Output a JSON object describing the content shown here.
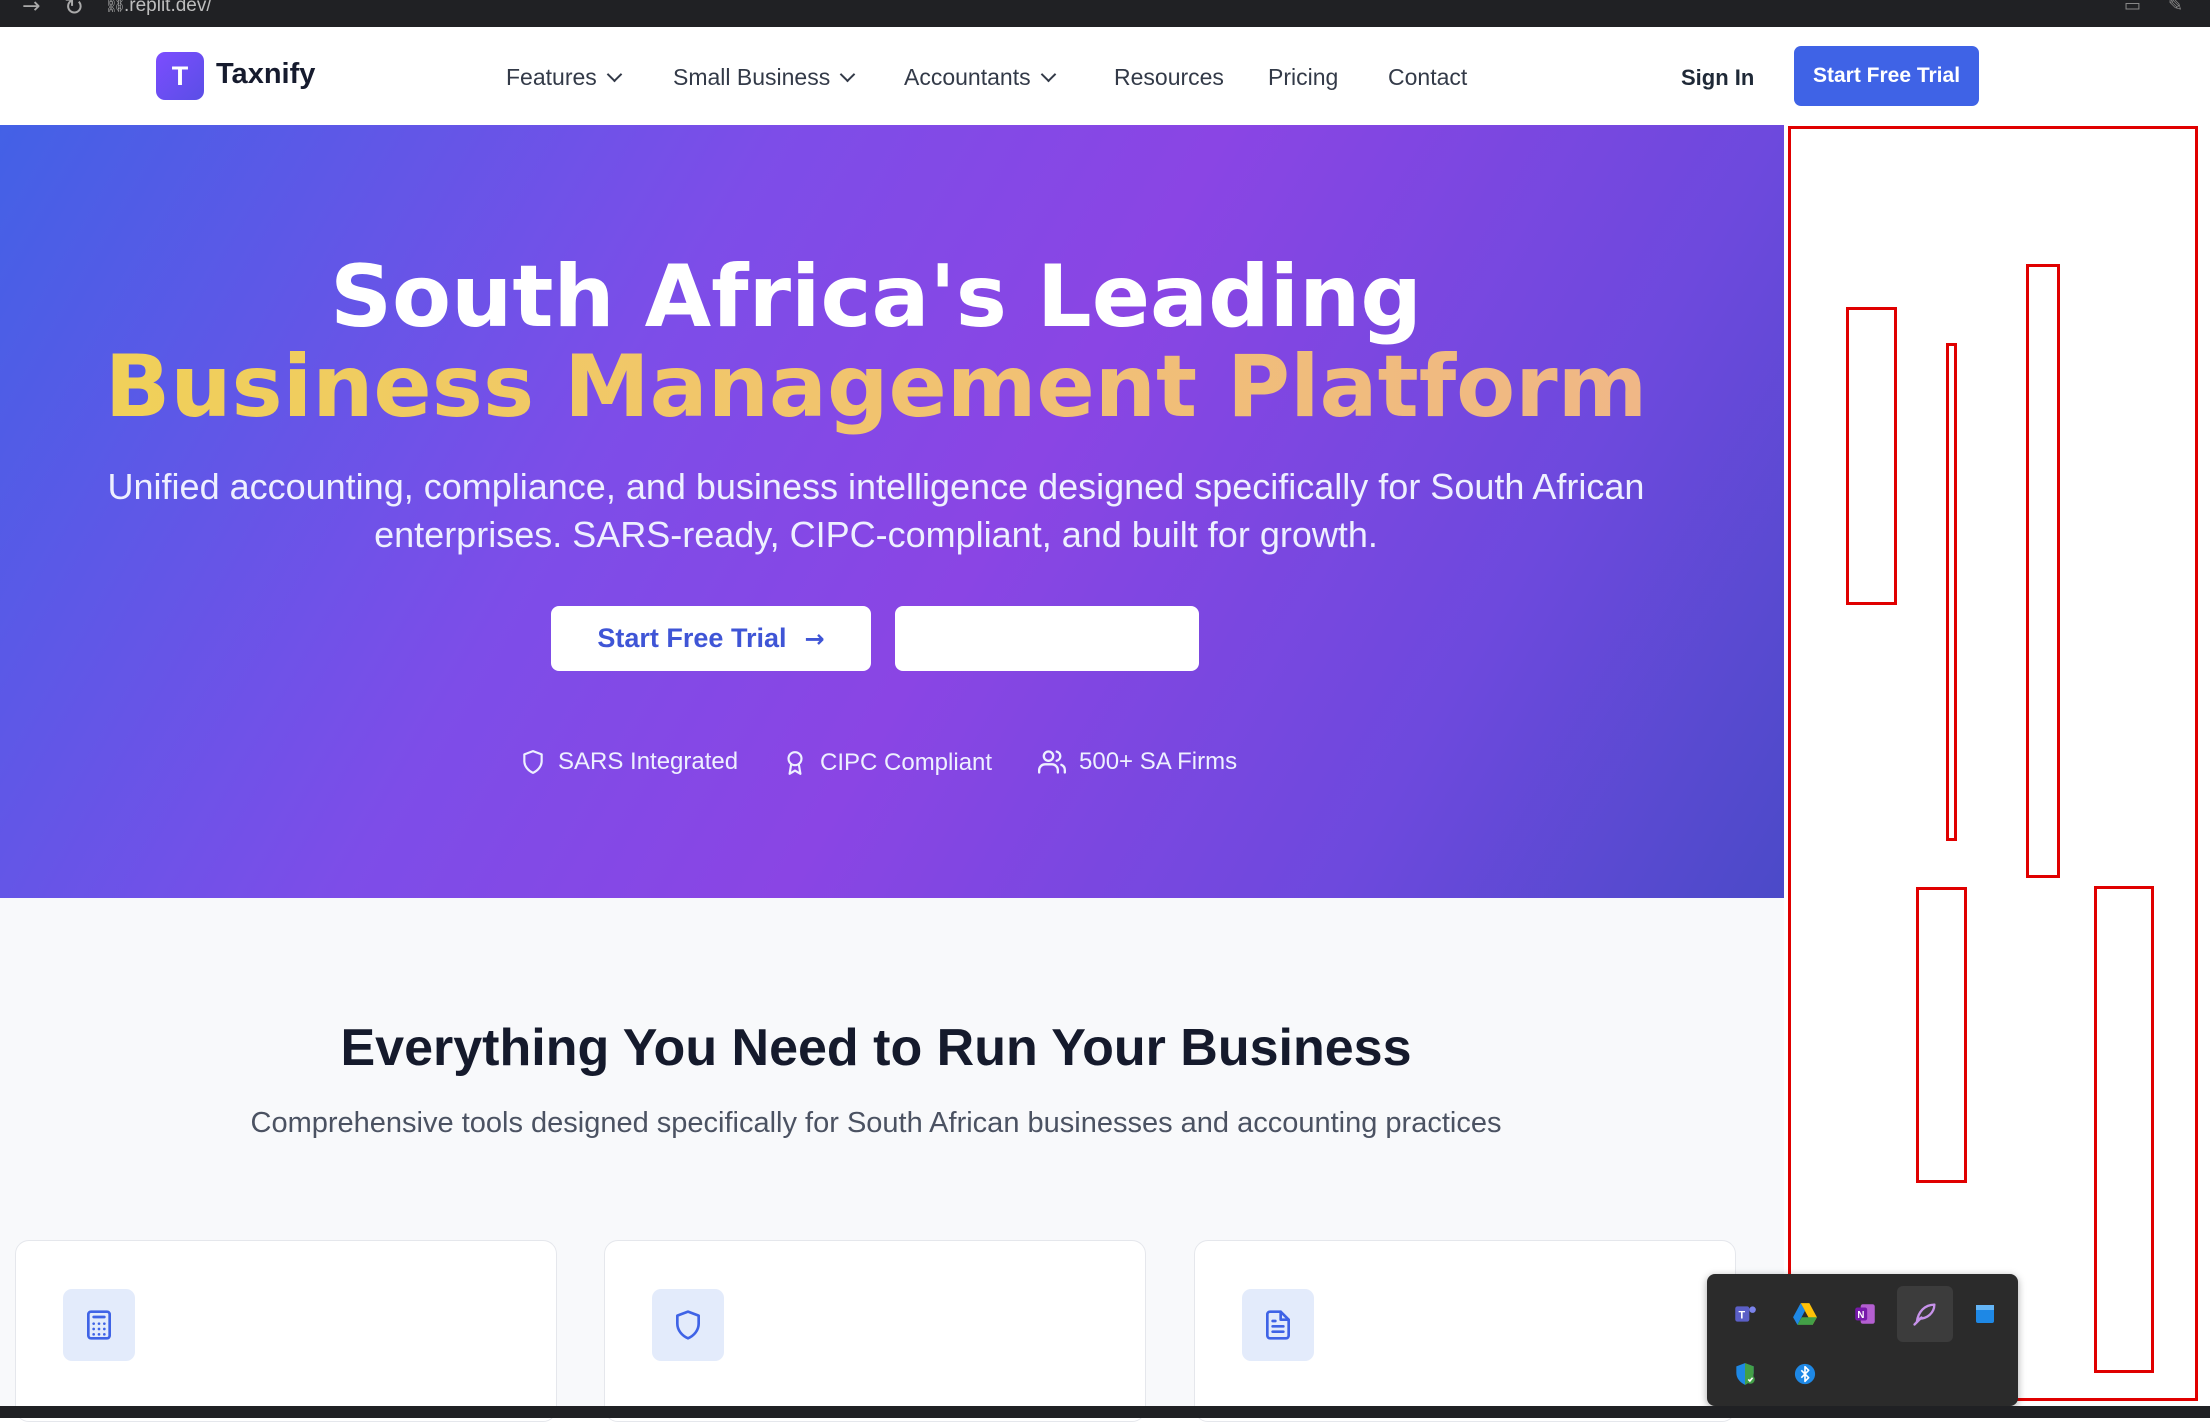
{
  "browser": {
    "url": ".replit.dev/"
  },
  "header": {
    "logo_letter": "T",
    "brand": "Taxnify",
    "nav": [
      {
        "label": "Features",
        "dropdown": true
      },
      {
        "label": "Small Business",
        "dropdown": true
      },
      {
        "label": "Accountants",
        "dropdown": true
      },
      {
        "label": "Resources",
        "dropdown": false
      },
      {
        "label": "Pricing",
        "dropdown": false
      },
      {
        "label": "Contact",
        "dropdown": false
      }
    ],
    "sign_in": "Sign In",
    "cta": "Start Free Trial"
  },
  "hero": {
    "title_line1": "South Africa's Leading",
    "title_line2": "Business Management Platform",
    "subtitle": "Unified accounting, compliance, and business intelligence designed specifically for South African enterprises. SARS-ready, CIPC-compliant, and built for growth.",
    "primary_button": "Start Free Trial",
    "secondary_button": "",
    "badges": [
      {
        "icon": "shield-icon",
        "label": "SARS Integrated"
      },
      {
        "icon": "award-icon",
        "label": "CIPC Compliant"
      },
      {
        "icon": "users-icon",
        "label": "500+ SA Firms"
      }
    ],
    "colors": {
      "gradient_start": "#4361e6",
      "gradient_mid": "#8a45e4",
      "gradient_end": "#4b4ac8",
      "title_accent": "#f0d256"
    }
  },
  "features": {
    "title": "Everything You Need to Run Your Business",
    "subtitle": "Comprehensive tools designed specifically for South African businesses and accounting practices",
    "cards": [
      {
        "icon": "calculator-icon"
      },
      {
        "icon": "shield-icon"
      },
      {
        "icon": "document-icon"
      }
    ]
  },
  "tray": {
    "icons": [
      "teams-icon",
      "google-drive-icon",
      "onenote-icon",
      "feather-icon",
      "windows-app-icon",
      "security-shield-icon",
      "bluetooth-icon"
    ]
  },
  "colors": {
    "primary_button": "#3f63e6",
    "annotation_red": "#e00000"
  }
}
